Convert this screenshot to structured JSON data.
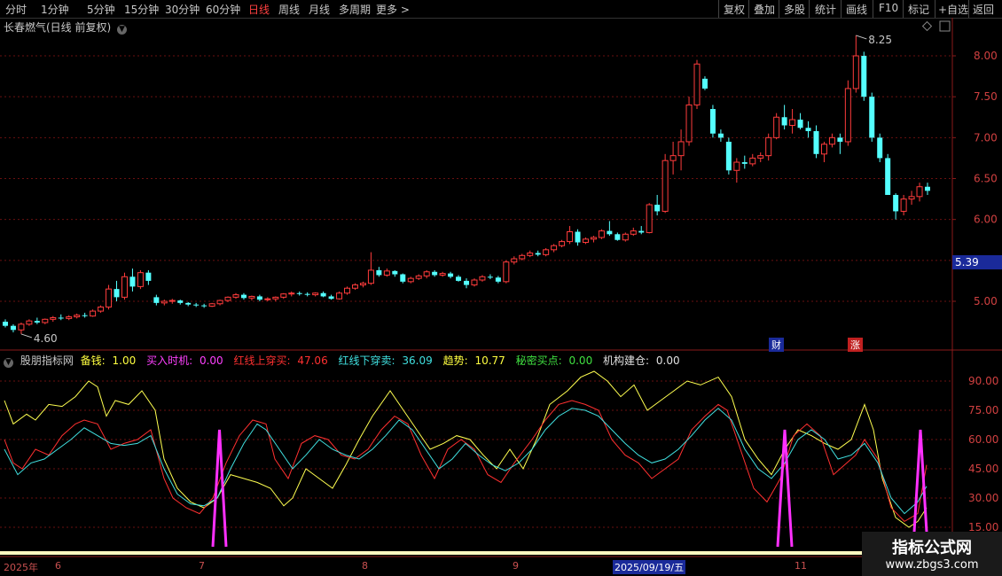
{
  "toolbar": {
    "periods": [
      "分时",
      "1分钟",
      "5分钟",
      "15分钟",
      "30分钟",
      "60分钟",
      "日线",
      "周线",
      "月线",
      "多周期",
      "更多 >"
    ],
    "active_period": "日线",
    "buttons": [
      "复权",
      "叠加",
      "多股",
      "统计",
      "画线",
      "F10",
      "标记",
      "+自选",
      "返回"
    ]
  },
  "chart_header": {
    "title": "长春燃气(日线 前复权)"
  },
  "price_axis": {
    "ticks": [
      "8.00",
      "7.50",
      "7.00",
      "6.50",
      "6.00",
      "5.00"
    ],
    "current_price": "5.39",
    "high_label": "8.25",
    "low_label": "4.60"
  },
  "event_badges": {
    "fin": "财",
    "up": "涨"
  },
  "indicator": {
    "name": "股朋指标网",
    "items": [
      {
        "label": "备钱: ",
        "value": "1.00",
        "color": "#ffff40"
      },
      {
        "label": "买入时机: ",
        "value": "0.00",
        "color": "#ff40ff"
      },
      {
        "label": "红线上穿买: ",
        "value": "47.06",
        "color": "#ff3030"
      },
      {
        "label": "红线下穿卖: ",
        "value": "36.09",
        "color": "#40e0e0"
      },
      {
        "label": "趋势: ",
        "value": "10.77",
        "color": "#ffff40"
      },
      {
        "label": "秘密买点: ",
        "value": "0.00",
        "color": "#40e040"
      },
      {
        "label": "机构建仓: ",
        "value": "0.00",
        "color": "#e0e0e0"
      }
    ],
    "axis_ticks": [
      "90.00",
      "75.00",
      "60.00",
      "45.00",
      "30.00",
      "15.00"
    ]
  },
  "dates": {
    "year": "2025年",
    "months": [
      "6",
      "7",
      "8",
      "9",
      "11"
    ],
    "cursor_date": "2025/09/19/五"
  },
  "watermark": {
    "line1": "指标公式网",
    "line2": "www.zbgs3.com"
  },
  "chart_data": {
    "type": "candlestick",
    "title": "长春燃气(日线 前复权)",
    "ohlc": [
      [
        4.75,
        4.78,
        4.68,
        4.7
      ],
      [
        4.7,
        4.72,
        4.62,
        4.65
      ],
      [
        4.65,
        4.74,
        4.6,
        4.72
      ],
      [
        4.72,
        4.78,
        4.7,
        4.76
      ],
      [
        4.76,
        4.8,
        4.72,
        4.74
      ],
      [
        4.74,
        4.79,
        4.72,
        4.78
      ],
      [
        4.78,
        4.82,
        4.75,
        4.8
      ],
      [
        4.8,
        4.84,
        4.77,
        4.79
      ],
      [
        4.79,
        4.83,
        4.77,
        4.81
      ],
      [
        4.81,
        4.85,
        4.79,
        4.83
      ],
      [
        4.83,
        4.86,
        4.8,
        4.82
      ],
      [
        4.82,
        4.9,
        4.81,
        4.88
      ],
      [
        4.88,
        4.95,
        4.86,
        4.93
      ],
      [
        4.93,
        5.2,
        4.9,
        5.15
      ],
      [
        5.15,
        5.25,
        5.0,
        5.05
      ],
      [
        5.05,
        5.35,
        5.02,
        5.3
      ],
      [
        5.3,
        5.4,
        5.12,
        5.18
      ],
      [
        5.18,
        5.38,
        5.15,
        5.35
      ],
      [
        5.35,
        5.38,
        5.2,
        5.25
      ],
      [
        5.05,
        5.08,
        4.95,
        4.98
      ],
      [
        4.98,
        5.02,
        4.95,
        5.0
      ],
      [
        5.0,
        5.03,
        4.97,
        5.01
      ],
      [
        5.01,
        5.02,
        4.96,
        4.98
      ],
      [
        4.98,
        4.99,
        4.94,
        4.96
      ],
      [
        4.96,
        4.98,
        4.93,
        4.95
      ],
      [
        4.95,
        4.97,
        4.92,
        4.94
      ],
      [
        4.94,
        4.98,
        4.93,
        4.97
      ],
      [
        4.97,
        5.02,
        4.95,
        5.01
      ],
      [
        5.01,
        5.06,
        4.99,
        5.05
      ],
      [
        5.05,
        5.1,
        5.03,
        5.08
      ],
      [
        5.08,
        5.1,
        5.02,
        5.04
      ],
      [
        5.04,
        5.07,
        5.01,
        5.06
      ],
      [
        5.06,
        5.08,
        5.0,
        5.02
      ],
      [
        5.02,
        5.05,
        5.0,
        5.03
      ],
      [
        5.03,
        5.06,
        5.0,
        5.05
      ],
      [
        5.05,
        5.1,
        5.03,
        5.09
      ],
      [
        5.09,
        5.12,
        5.06,
        5.1
      ],
      [
        5.1,
        5.12,
        5.07,
        5.09
      ],
      [
        5.09,
        5.11,
        5.06,
        5.08
      ],
      [
        5.08,
        5.11,
        5.06,
        5.1
      ],
      [
        5.1,
        5.12,
        5.05,
        5.06
      ],
      [
        5.06,
        5.08,
        5.02,
        5.03
      ],
      [
        5.03,
        5.12,
        5.02,
        5.1
      ],
      [
        5.1,
        5.18,
        5.08,
        5.16
      ],
      [
        5.16,
        5.22,
        5.14,
        5.2
      ],
      [
        5.2,
        5.24,
        5.17,
        5.22
      ],
      [
        5.22,
        5.6,
        5.2,
        5.38
      ],
      [
        5.38,
        5.42,
        5.3,
        5.32
      ],
      [
        5.32,
        5.4,
        5.3,
        5.37
      ],
      [
        5.37,
        5.38,
        5.3,
        5.33
      ],
      [
        5.33,
        5.34,
        5.22,
        5.24
      ],
      [
        5.24,
        5.3,
        5.22,
        5.28
      ],
      [
        5.28,
        5.33,
        5.26,
        5.31
      ],
      [
        5.31,
        5.38,
        5.28,
        5.36
      ],
      [
        5.36,
        5.38,
        5.3,
        5.32
      ],
      [
        5.32,
        5.36,
        5.3,
        5.34
      ],
      [
        5.34,
        5.36,
        5.28,
        5.3
      ],
      [
        5.3,
        5.32,
        5.24,
        5.25
      ],
      [
        5.25,
        5.28,
        5.16,
        5.2
      ],
      [
        5.2,
        5.28,
        5.18,
        5.26
      ],
      [
        5.26,
        5.32,
        5.24,
        5.3
      ],
      [
        5.3,
        5.33,
        5.27,
        5.29
      ],
      [
        5.29,
        5.31,
        5.22,
        5.24
      ],
      [
        5.24,
        5.5,
        5.22,
        5.48
      ],
      [
        5.48,
        5.55,
        5.45,
        5.52
      ],
      [
        5.52,
        5.58,
        5.5,
        5.56
      ],
      [
        5.56,
        5.62,
        5.54,
        5.59
      ],
      [
        5.59,
        5.62,
        5.55,
        5.57
      ],
      [
        5.57,
        5.65,
        5.55,
        5.63
      ],
      [
        5.63,
        5.7,
        5.6,
        5.68
      ],
      [
        5.68,
        5.75,
        5.66,
        5.73
      ],
      [
        5.73,
        5.92,
        5.7,
        5.85
      ],
      [
        5.85,
        5.88,
        5.68,
        5.72
      ],
      [
        5.72,
        5.78,
        5.7,
        5.76
      ],
      [
        5.76,
        5.8,
        5.72,
        5.78
      ],
      [
        5.78,
        5.88,
        5.76,
        5.86
      ],
      [
        5.86,
        5.98,
        5.8,
        5.82
      ],
      [
        5.82,
        5.84,
        5.74,
        5.75
      ],
      [
        5.75,
        5.84,
        5.73,
        5.82
      ],
      [
        5.82,
        5.9,
        5.8,
        5.86
      ],
      [
        5.86,
        5.92,
        5.82,
        5.84
      ],
      [
        5.84,
        6.2,
        5.83,
        6.18
      ],
      [
        6.18,
        6.3,
        6.05,
        6.1
      ],
      [
        6.1,
        6.8,
        6.08,
        6.72
      ],
      [
        6.72,
        6.95,
        6.55,
        6.78
      ],
      [
        6.78,
        7.1,
        6.6,
        6.95
      ],
      [
        6.95,
        7.5,
        6.9,
        7.4
      ],
      [
        7.4,
        7.95,
        7.35,
        7.9
      ],
      [
        7.72,
        7.75,
        7.58,
        7.6
      ],
      [
        7.35,
        7.4,
        7.0,
        7.05
      ],
      [
        7.05,
        7.1,
        6.95,
        7.0
      ],
      [
        6.95,
        7.0,
        6.55,
        6.6
      ],
      [
        6.6,
        6.75,
        6.45,
        6.7
      ],
      [
        6.7,
        6.78,
        6.62,
        6.68
      ],
      [
        6.68,
        6.8,
        6.65,
        6.75
      ],
      [
        6.75,
        6.82,
        6.7,
        6.78
      ],
      [
        6.78,
        7.05,
        6.72,
        7.0
      ],
      [
        7.0,
        7.3,
        6.98,
        7.25
      ],
      [
        7.25,
        7.4,
        7.1,
        7.15
      ],
      [
        7.15,
        7.35,
        7.05,
        7.22
      ],
      [
        7.22,
        7.3,
        7.1,
        7.12
      ],
      [
        7.12,
        7.2,
        7.0,
        7.08
      ],
      [
        7.08,
        7.15,
        6.75,
        6.8
      ],
      [
        6.8,
        6.95,
        6.7,
        6.92
      ],
      [
        6.92,
        7.05,
        6.88,
        7.0
      ],
      [
        7.0,
        7.05,
        6.8,
        6.95
      ],
      [
        6.95,
        7.7,
        6.9,
        7.6
      ],
      [
        7.6,
        8.25,
        7.55,
        8.0
      ],
      [
        8.0,
        8.05,
        7.45,
        7.5
      ],
      [
        7.5,
        7.55,
        6.95,
        7.0
      ],
      [
        7.0,
        7.05,
        6.7,
        6.75
      ],
      [
        6.75,
        6.8,
        6.3,
        6.3
      ],
      [
        6.3,
        6.32,
        6.0,
        6.1
      ],
      [
        6.1,
        6.3,
        6.05,
        6.25
      ],
      [
        6.25,
        6.35,
        6.18,
        6.28
      ],
      [
        6.28,
        6.45,
        6.22,
        6.4
      ],
      [
        6.4,
        6.45,
        6.3,
        6.35
      ]
    ]
  }
}
